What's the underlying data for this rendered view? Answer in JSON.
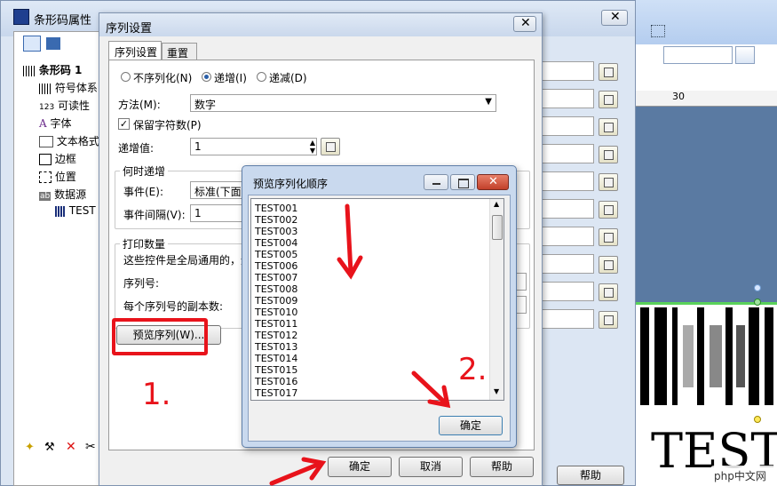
{
  "main_window": {
    "title": "条形码属性",
    "tree": [
      {
        "label": "条形码 1",
        "icon": "barcode-icon"
      },
      {
        "label": "符号体系",
        "icon": "barcode-icon"
      },
      {
        "label": "可读性",
        "icon": "123-icon",
        "icon_text": "123"
      },
      {
        "label": "字体",
        "icon": "font-icon",
        "icon_text": "A"
      },
      {
        "label": "文本格式",
        "icon": "text-format-icon"
      },
      {
        "label": "边框",
        "icon": "border-icon"
      },
      {
        "label": "位置",
        "icon": "position-icon"
      },
      {
        "label": "数据源",
        "icon": "data-source-icon",
        "icon_text": "ab"
      },
      {
        "label": "TEST",
        "icon": "barcode-small-icon"
      }
    ],
    "help_label": "帮助"
  },
  "right_area": {
    "ruler_number": "30",
    "preview_text": "TEST"
  },
  "serial_dialog": {
    "title": "序列设置",
    "tabs": [
      "序列设置",
      "重置"
    ],
    "radio_none": "不序列化(N)",
    "radio_inc": "递增(I)",
    "radio_dec": "递减(D)",
    "method_label": "方法(M):",
    "method_value": "数字",
    "keep_chars_label": "保留字符数(P)",
    "increment_label": "递增值:",
    "increment_value": "1",
    "when_group": "何时递增",
    "event_label": "事件(E):",
    "event_value": "标准(下面的",
    "interval_label": "事件间隔(V):",
    "interval_value": "1",
    "print_group": "打印数量",
    "global_note": "这些控件是全局通用的，无",
    "serial_no_label": "序列号:",
    "copies_label": "每个序列号的副本数:",
    "preview_button": "预览序列(W)...",
    "ok": "确定",
    "cancel": "取消",
    "help": "帮助"
  },
  "preview_dialog": {
    "title": "预览序列化顺序",
    "items": [
      "TEST001",
      "TEST002",
      "TEST003",
      "TEST004",
      "TEST005",
      "TEST006",
      "TEST007",
      "TEST008",
      "TEST009",
      "TEST010",
      "TEST011",
      "TEST012",
      "TEST013",
      "TEST014",
      "TEST015",
      "TEST016",
      "TEST017"
    ],
    "ok": "确定"
  },
  "annotations": {
    "step1": "1.",
    "step2": "2.",
    "color": "#e8131b"
  },
  "watermark": {
    "text": "php中文网"
  }
}
